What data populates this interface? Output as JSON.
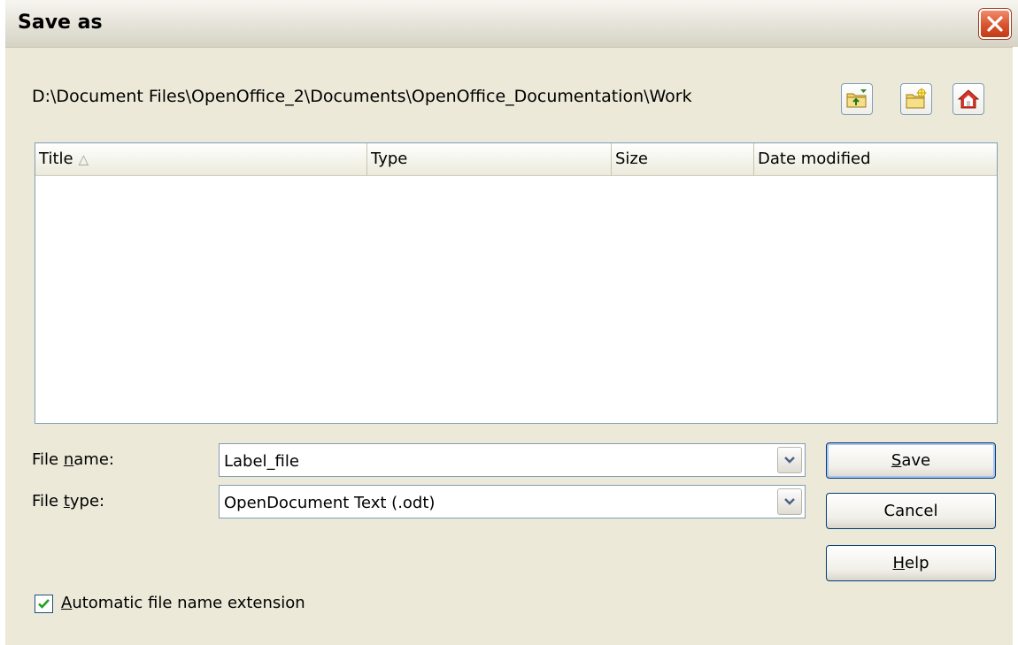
{
  "window": {
    "title": "Save as"
  },
  "toolbar": {
    "path": "D:\\Document Files\\OpenOffice_2\\Documents\\OpenOffice_Documentation\\Work",
    "buttons": [
      {
        "icon": "up-folder-icon"
      },
      {
        "icon": "new-folder-icon"
      },
      {
        "icon": "home-icon"
      }
    ]
  },
  "file_list": {
    "columns": [
      {
        "label": "Title",
        "sort_indicator": "△"
      },
      {
        "label": "Type"
      },
      {
        "label": "Size"
      },
      {
        "label": "Date modified"
      }
    ],
    "rows": []
  },
  "form": {
    "file_name": {
      "label_pre": "File ",
      "label_key": "n",
      "label_post": "ame:",
      "value": "Label_file"
    },
    "file_type": {
      "label_pre": "File ",
      "label_key": "t",
      "label_post": "ype:",
      "value": "OpenDocument Text (.odt)"
    }
  },
  "buttons": {
    "save": {
      "key": "S",
      "rest": "ave"
    },
    "cancel": {
      "label": "Cancel"
    },
    "help": {
      "key": "H",
      "rest": "elp"
    }
  },
  "options": {
    "auto_extension": {
      "key": "A",
      "rest": "utomatic file name extension",
      "checked": true
    }
  },
  "colors": {
    "dialog_bg": "#ece9d8",
    "close_button": "#d8532e",
    "border_accent": "#7f9db9"
  }
}
